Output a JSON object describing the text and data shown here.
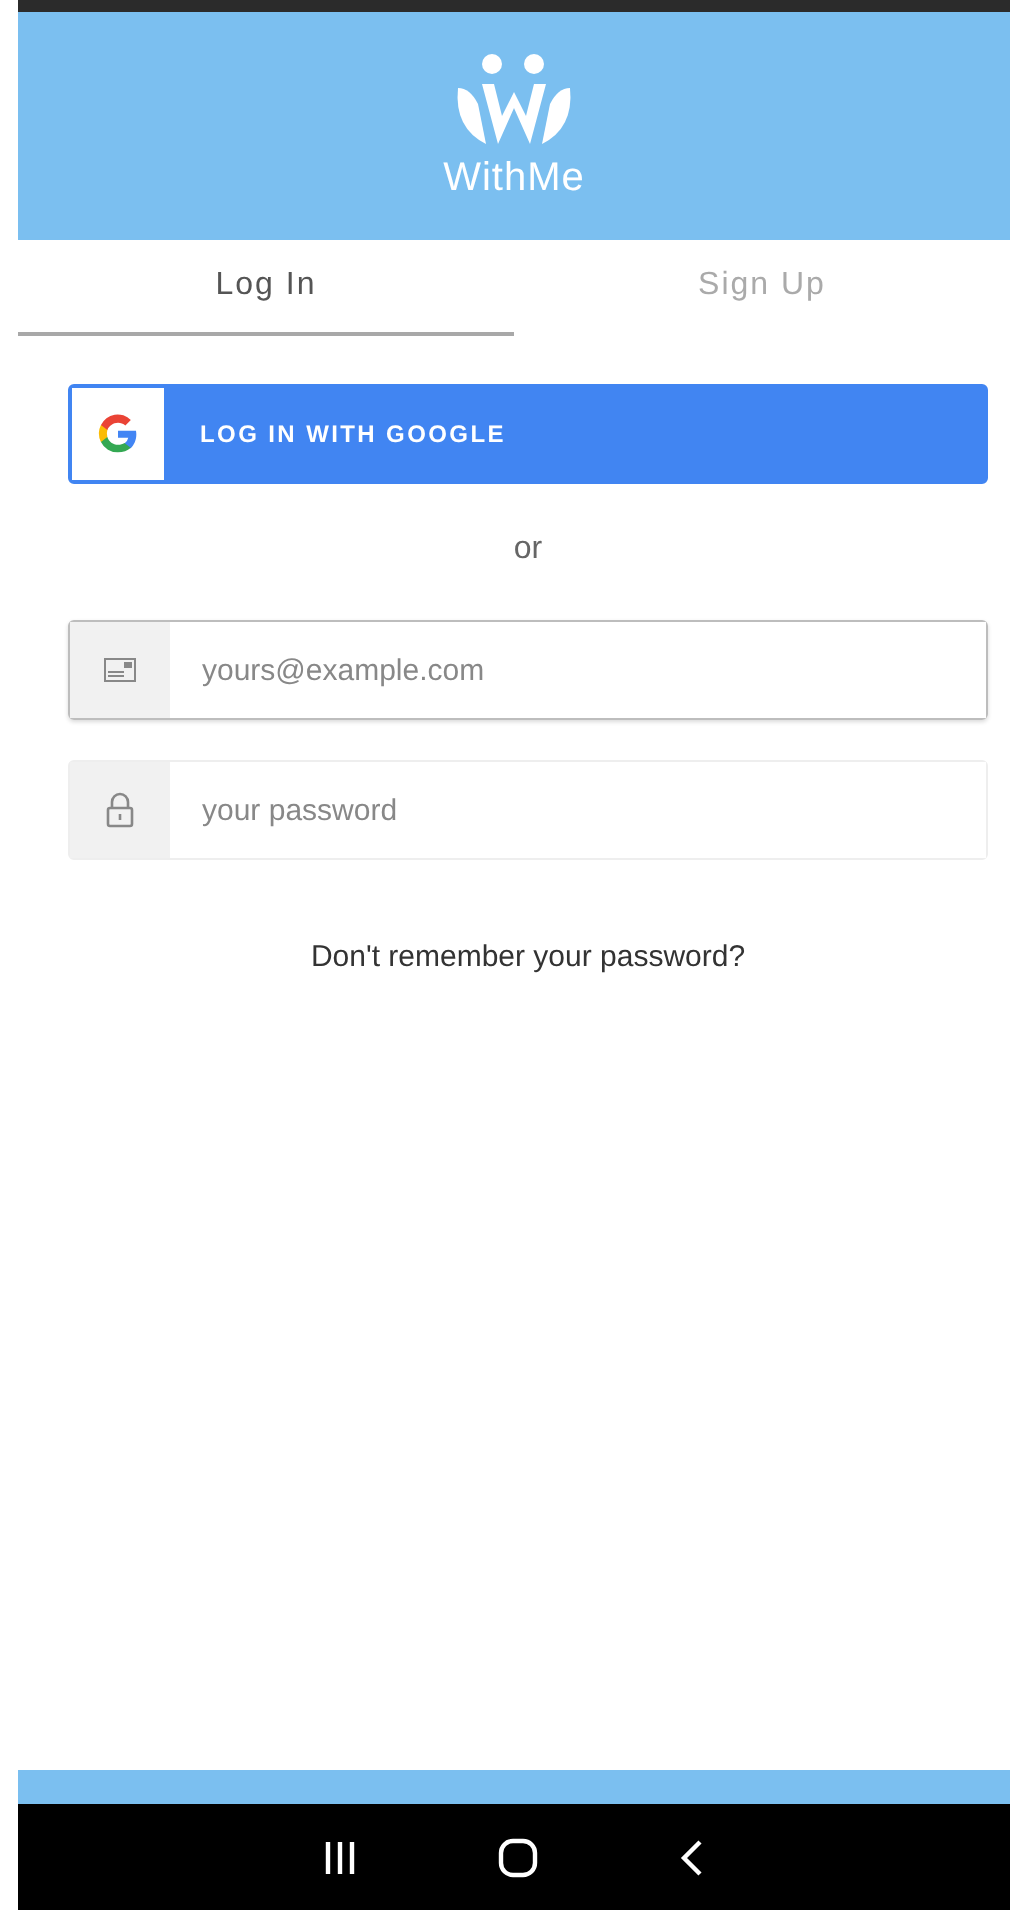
{
  "header": {
    "logo_text": "WithMe"
  },
  "tabs": [
    {
      "label": "Log In",
      "selected": true
    },
    {
      "label": "Sign Up",
      "selected": false
    }
  ],
  "google_button": {
    "label": "LOG IN WITH GOOGLE"
  },
  "separator": "or",
  "fields": [
    {
      "kind": "email",
      "placeholder": "yours@example.com",
      "focused": true
    },
    {
      "kind": "password",
      "placeholder": "your password",
      "focused": false
    }
  ],
  "forgot_link": "Don't remember your password?"
}
